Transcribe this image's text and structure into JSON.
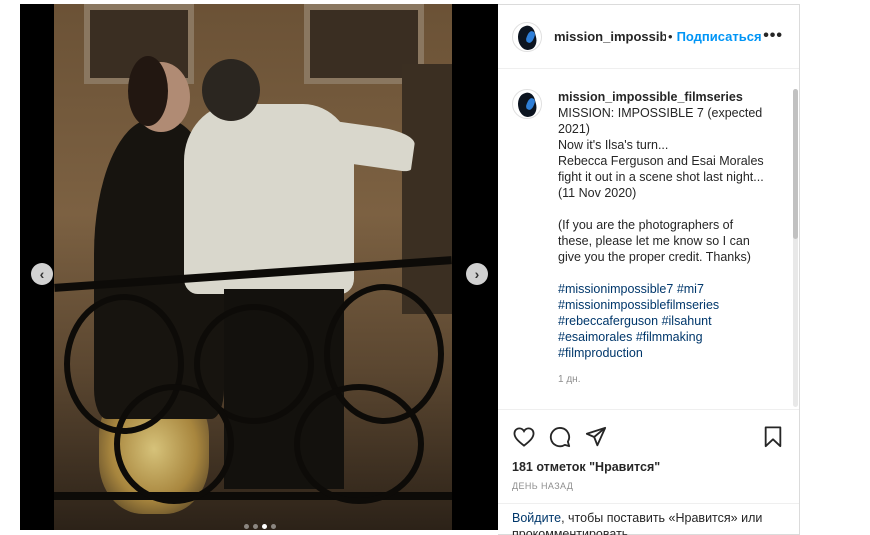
{
  "post": {
    "image_alt": "",
    "carousel": {
      "total": 4,
      "active": 3
    },
    "nav": {
      "prev": "‹",
      "next": "›"
    }
  },
  "header": {
    "username": "mission_impossible_filmseries",
    "separator": "•",
    "follow_label": "Подписаться",
    "more_label": "•••"
  },
  "caption": {
    "username": "mission_impossible_filmseries",
    "lines": [
      "MISSION: IMPOSSIBLE 7 (expected",
      "2021)",
      "Now it's Ilsa's turn...",
      "Rebecca Ferguson and Esai Morales",
      "fight it out in a scene shot last night...",
      "(11 Nov 2020)",
      "",
      "(If you are the photographers of",
      "these, please let me know so I can",
      "give you the proper credit. Thanks)",
      ""
    ],
    "hashtag_lines": [
      [
        "#missionimpossible7",
        "#mi7"
      ],
      [
        "#missionimpossiblefilmseries"
      ],
      [
        "#rebeccaferguson",
        "#ilsahunt"
      ],
      [
        "#esaimorales",
        "#filmmaking"
      ],
      [
        "#filmproduction"
      ]
    ],
    "time": "1 дн."
  },
  "actions": {
    "like_icon": "heart-icon",
    "comment_icon": "comment-icon",
    "share_icon": "paper-plane-icon",
    "save_icon": "bookmark-icon",
    "likes_text": "181 отметок \"Нравится\"",
    "date_text": "ДЕНЬ НАЗАД"
  },
  "login": {
    "link": "Войдите",
    "text": ", чтобы поставить «Нравится» или прокомментировать."
  },
  "colors": {
    "accent": "#0095f6",
    "hashtag": "#00376b",
    "muted": "#8e8e8e"
  }
}
